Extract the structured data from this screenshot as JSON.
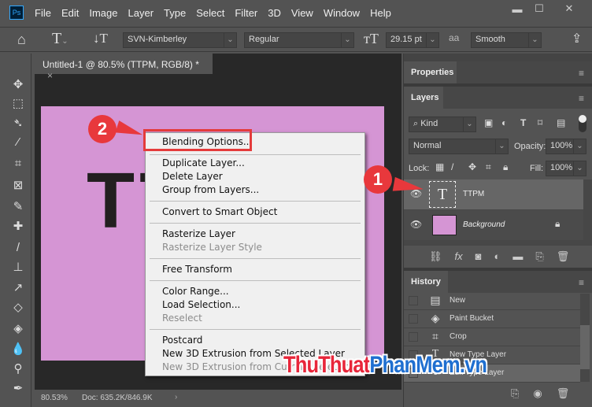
{
  "app": {
    "logo": "Ps",
    "menus": [
      "File",
      "Edit",
      "Image",
      "Layer",
      "Type",
      "Select",
      "Filter",
      "3D",
      "View",
      "Window",
      "Help"
    ],
    "window_controls": [
      "minimize-icon",
      "maximize-icon",
      "close-icon"
    ]
  },
  "options": {
    "font_family": "SVN-Kimberley",
    "font_style": "Regular",
    "font_size": "29.15 pt",
    "antialias_icon": "aa",
    "antialias": "Smooth"
  },
  "document": {
    "tab_title": "Untitled-1 @ 80.5% (TTPM, RGB/8) *",
    "close": "×",
    "canvas_color": "#d595d4",
    "canvas_text": "TT",
    "zoom": "80.53%",
    "doc_info": "Doc: 635.2K/846.9K"
  },
  "tools": [
    "move",
    "marquee",
    "lasso",
    "magic-wand",
    "crop",
    "frame",
    "eyedropper",
    "healing-brush",
    "brush",
    "clone-stamp",
    "history-brush",
    "eraser",
    "paint-bucket",
    "blur",
    "dodge",
    "pen"
  ],
  "context_menu": {
    "items": [
      {
        "label": "Blending Options...",
        "disabled": false
      },
      {
        "label": "Duplicate Layer...",
        "disabled": false
      },
      {
        "label": "Delete Layer",
        "disabled": false
      },
      {
        "label": "Group from Layers...",
        "disabled": false
      },
      {
        "label": "Convert to Smart Object",
        "disabled": false
      },
      {
        "label": "Rasterize Layer",
        "disabled": false
      },
      {
        "label": "Rasterize Layer Style",
        "disabled": true
      },
      {
        "label": "Free Transform",
        "disabled": false
      },
      {
        "label": "Color Range...",
        "disabled": false
      },
      {
        "label": "Load Selection...",
        "disabled": false
      },
      {
        "label": "Reselect",
        "disabled": true
      },
      {
        "label": "Postcard",
        "disabled": false
      },
      {
        "label": "New 3D Extrusion from Selected Layer",
        "disabled": false
      },
      {
        "label": "New 3D Extrusion from Current Selection",
        "disabled": true
      }
    ]
  },
  "annotations": {
    "step1": "1",
    "step2": "2",
    "accent": "#e8383c"
  },
  "panels": {
    "properties": {
      "title": "Properties"
    },
    "layers": {
      "title": "Layers",
      "filter": "Kind",
      "blend_mode": "Normal",
      "opacity_label": "Opacity:",
      "opacity": "100%",
      "lock_label": "Lock:",
      "fill_label": "Fill:",
      "fill": "100%",
      "items": [
        {
          "name": "TTPM",
          "type": "text",
          "selected": true
        },
        {
          "name": "Background",
          "type": "fill",
          "color": "#d595d4",
          "locked": true
        }
      ]
    },
    "history": {
      "title": "History",
      "items": [
        "New",
        "Paint Bucket",
        "Crop",
        "New Type Layer",
        "Edit Type Layer"
      ]
    }
  },
  "watermark": {
    "part1": "ThuThuat",
    "part2": "PhanMem.vn",
    "color1": "#e8263a",
    "color2": "#1f6fd0"
  }
}
